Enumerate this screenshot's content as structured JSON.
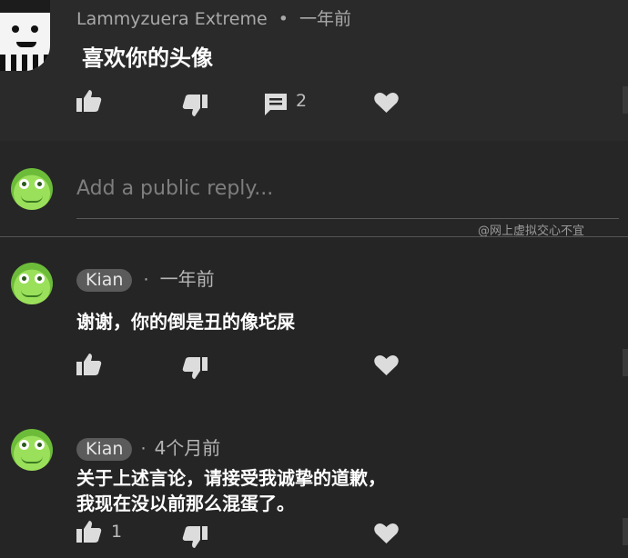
{
  "top_comment": {
    "author": "Lammyzuera Extreme",
    "separator": "•",
    "time": "一年前",
    "text": "喜欢你的头像",
    "reply_count": "2"
  },
  "reply_box": {
    "placeholder": "Add a public reply..."
  },
  "watermark": "@网上虚拟交心不宜",
  "replies": [
    {
      "author": "Kian",
      "separator": "·",
      "time": "一年前",
      "text": "谢谢，你的倒是丑的像坨屎"
    },
    {
      "author": "Kian",
      "separator": "·",
      "time": "4个月前",
      "text_line1": "关于上述言论，请接受我诚挚的道歉，",
      "text_line2": "我现在没以前那么混蛋了。",
      "like_count": "1"
    }
  ],
  "icons": {
    "like": "thumbs-up-icon",
    "dislike": "thumbs-down-icon",
    "reply": "comment-icon",
    "heart": "heart-icon"
  },
  "colors": {
    "background": "#252525",
    "text": "#ffffff",
    "muted": "#a9a9a9",
    "avatar_green": "#9be05a"
  }
}
